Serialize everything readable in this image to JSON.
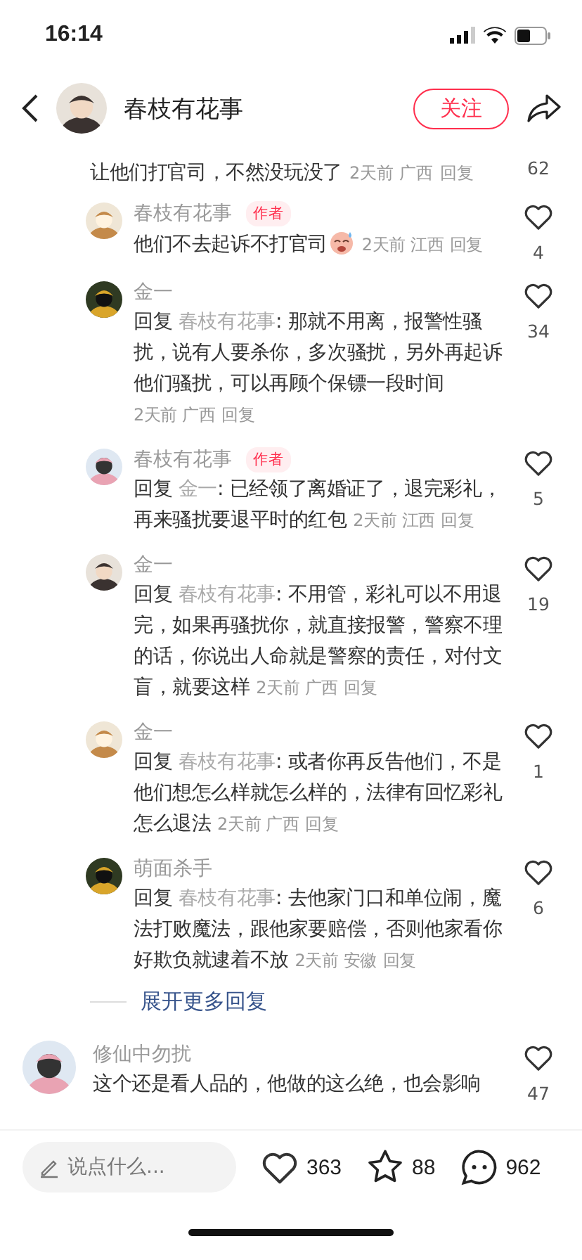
{
  "status_bar": {
    "time": "16:14"
  },
  "header": {
    "author": "春枝有花事",
    "follow_button": "关注"
  },
  "comments": [
    {
      "kind": "partial",
      "text": "让他们打官司，不然没玩没了",
      "time": "2天前",
      "location": "广西",
      "reply_label": "回复",
      "likes": "62"
    },
    {
      "kind": "reply",
      "user": "春枝有花事",
      "author_tag": "作者",
      "text": "他们不去起诉不打官司",
      "has_emoji": true,
      "time": "2天前",
      "location": "江西",
      "reply_label": "回复",
      "likes": "4"
    },
    {
      "kind": "reply",
      "user": "金一",
      "reply_prefix": "回复",
      "reply_to": "春枝有花事",
      "text": ": 那就不用离，报警性骚扰，说有人要杀你，多次骚扰，另外再起诉他们骚扰，可以再顾个保镖一段时间",
      "time": "2天前",
      "location": "广西",
      "reply_label": "回复",
      "likes": "34"
    },
    {
      "kind": "reply",
      "user": "春枝有花事",
      "author_tag": "作者",
      "reply_prefix": "回复",
      "reply_to": "金一",
      "text": ": 已经领了离婚证了，退完彩礼，再来骚扰要退平时的红包",
      "time": "2天前",
      "location": "江西",
      "reply_label": "回复",
      "likes": "5"
    },
    {
      "kind": "reply",
      "user": "金一",
      "reply_prefix": "回复",
      "reply_to": "春枝有花事",
      "text": ": 不用管，彩礼可以不用退完，如果再骚扰你，就直接报警，警察不理的话，你说出人命就是警察的责任，对付文盲，就要这样",
      "time": "2天前",
      "location": "广西",
      "reply_label": "回复",
      "likes": "19"
    },
    {
      "kind": "reply",
      "user": "金一",
      "reply_prefix": "回复",
      "reply_to": "春枝有花事",
      "text": ": 或者你再反告他们，不是他们想怎么样就怎么样的，法律有回忆彩礼怎么退法",
      "time": "2天前",
      "location": "广西",
      "reply_label": "回复",
      "likes": "1"
    },
    {
      "kind": "reply",
      "user": "萌面杀手",
      "reply_prefix": "回复",
      "reply_to": "春枝有花事",
      "text": ": 去他家门口和单位闹，魔法打败魔法，跟他家要赔偿，否则他家看你好欺负就逮着不放",
      "time": "2天前",
      "location": "安徽",
      "reply_label": "回复",
      "likes": "6"
    },
    {
      "kind": "more",
      "text": "展开更多回复"
    },
    {
      "kind": "top",
      "user": "修仙中勿扰",
      "text": "这个还是看人品的，他做的这么绝，也会影响",
      "likes": "47"
    }
  ],
  "bottom_bar": {
    "placeholder": "说点什么...",
    "likes": "363",
    "favorites": "88",
    "comments": "962"
  }
}
